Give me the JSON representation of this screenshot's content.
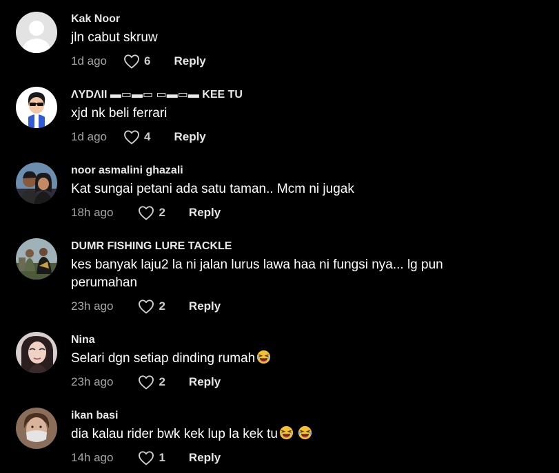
{
  "comments": [
    {
      "username": "Kak Noor",
      "text": "jln cabut skruw",
      "time": "1d ago",
      "likes": "6",
      "reply": "Reply",
      "avatar": "default-avatar"
    },
    {
      "username": "ΛYDΛII ▬▭▬▭ ▭▬▭▬ KEE TU",
      "text": "xjd nk beli ferrari",
      "time": "1d ago",
      "likes": "4",
      "reply": "Reply",
      "avatar": "cartoon-avatar"
    },
    {
      "username": "noor asmalini ghazali",
      "text": "Kat sungai petani ada satu taman.. Mcm ni jugak",
      "time": "18h ago",
      "likes": "2",
      "reply": "Reply",
      "avatar": "couple-photo-avatar"
    },
    {
      "username": "DUMR FISHING LURE TACKLE",
      "text": "kes banyak laju2 la ni jalan lurus lawa haa ni fungsi nya... lg pun perumahan",
      "time": "23h ago",
      "likes": "2",
      "reply": "Reply",
      "avatar": "group-photo-avatar"
    },
    {
      "username": "Nina",
      "text": "Selari dgn setiap dinding rumah",
      "time": "23h ago",
      "likes": "2",
      "reply": "Reply",
      "avatar": "selfie-avatar",
      "emojis": "laughing-emoji"
    },
    {
      "username": "ikan basi",
      "text": "dia kalau rider bwk kek lup la kek tu",
      "time": "14h ago",
      "likes": "1",
      "reply": "Reply",
      "avatar": "masked-face-avatar",
      "emojis": "laughing-emoji x2"
    }
  ],
  "colors": {
    "background": "#000000",
    "username": "#e8e8e8",
    "text": "#ffffff",
    "secondary": "#a7a7a7"
  },
  "icons": {
    "like": "heart-outline-icon",
    "emoji": "laughing-emoji-icon"
  }
}
